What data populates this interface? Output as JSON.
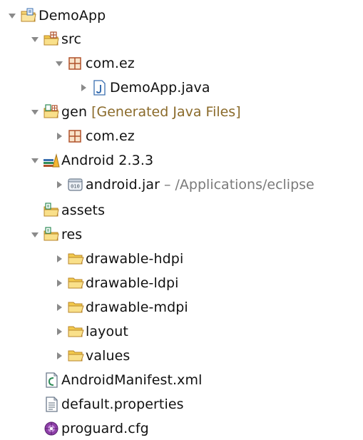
{
  "tree": {
    "project": {
      "label": "DemoApp"
    },
    "src": {
      "label": "src"
    },
    "src_pkg": {
      "label": "com.ez"
    },
    "src_file": {
      "label": "DemoApp.java"
    },
    "gen": {
      "label": "gen",
      "decoration": "[Generated Java Files]"
    },
    "gen_pkg": {
      "label": "com.ez"
    },
    "android_lib": {
      "label": "Android 2.3.3"
    },
    "android_jar": {
      "label": "android.jar",
      "decoration": "– /Applications/eclipse"
    },
    "assets": {
      "label": "assets"
    },
    "res": {
      "label": "res"
    },
    "res_items": [
      {
        "label": "drawable-hdpi"
      },
      {
        "label": "drawable-ldpi"
      },
      {
        "label": "drawable-mdpi"
      },
      {
        "label": "layout"
      },
      {
        "label": "values"
      }
    ],
    "manifest": {
      "label": "AndroidManifest.xml"
    },
    "properties": {
      "label": "default.properties"
    },
    "proguard": {
      "label": "proguard.cfg"
    }
  },
  "icons": {
    "project": "project-folder-icon",
    "source_folder": "source-folder-icon",
    "package": "package-icon",
    "java_file": "java-file-icon",
    "library": "library-icon",
    "jar": "jar-icon",
    "folder": "folder-icon",
    "xml_file": "xml-file-icon",
    "text_file": "text-file-icon",
    "config_file": "config-file-icon"
  },
  "colors": {
    "folder_yellow": "#f2c94c",
    "folder_stroke": "#b8862b",
    "package_brown": "#b0522b",
    "java_blue": "#3a6fb0",
    "decoration_gray": "#7a7a7a",
    "gen_decoration": "#8a6a2a"
  }
}
